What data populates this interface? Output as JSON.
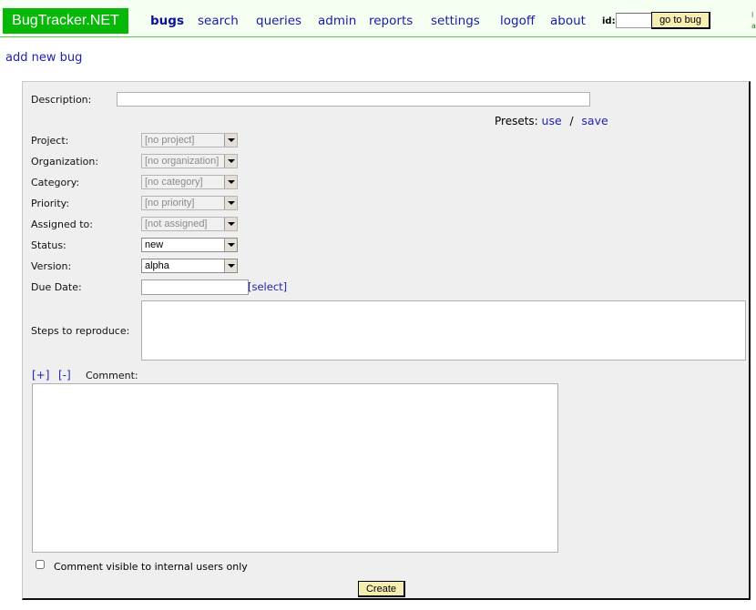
{
  "header": {
    "logo": "BugTracker.NET",
    "nav": [
      "bugs",
      "search",
      "queries",
      "admin",
      "reports",
      "settings",
      "logoff",
      "about"
    ],
    "active_nav": "bugs",
    "id_label": "id:",
    "id_value": "",
    "goto_label": "go to bug",
    "edge_text_1": "l",
    "edge_text_2": "a"
  },
  "page": {
    "add_link": "add new bug"
  },
  "form": {
    "description_label": "Description:",
    "description_value": "",
    "presets_label": "Presets:",
    "presets_use": "use",
    "presets_sep": "/",
    "presets_save": "save",
    "project_label": "Project:",
    "project_value": "[no project]",
    "organization_label": "Organization:",
    "organization_value": "[no organization]",
    "category_label": "Category:",
    "category_value": "[no category]",
    "priority_label": "Priority:",
    "priority_value": "[no priority]",
    "assigned_label": "Assigned to:",
    "assigned_value": "[not assigned]",
    "status_label": "Status:",
    "status_value": "new",
    "version_label": "Version:",
    "version_value": "alpha",
    "due_label": "Due Date:",
    "due_value": "",
    "due_select": "[select]",
    "steps_label": "Steps to reproduce:",
    "expand_label": "[+]",
    "collapse_label": "[-]",
    "comment_label": "Comment:",
    "internal_only_label": "Comment visible to internal users only",
    "create_label": "Create"
  }
}
